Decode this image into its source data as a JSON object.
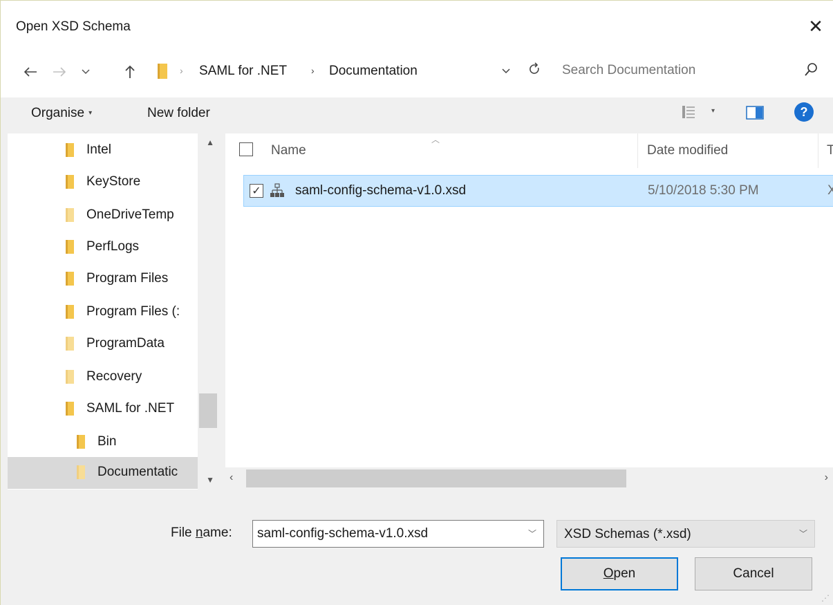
{
  "window": {
    "title": "Open XSD Schema",
    "close_glyph": "✕"
  },
  "address": {
    "breadcrumb": [
      "SAML for .NET",
      "Documentation"
    ],
    "search_placeholder": "Search Documentation"
  },
  "toolbar": {
    "organise_label": "Organise",
    "new_folder_label": "New folder",
    "help_glyph": "?"
  },
  "nav_tree": {
    "items": [
      {
        "label": "Intel",
        "folder_style": "dark"
      },
      {
        "label": "KeyStore",
        "folder_style": "dark"
      },
      {
        "label": "OneDriveTemp",
        "folder_style": "light"
      },
      {
        "label": "PerfLogs",
        "folder_style": "dark"
      },
      {
        "label": "Program Files",
        "folder_style": "dark"
      },
      {
        "label": "Program Files (:",
        "folder_style": "dark"
      },
      {
        "label": "ProgramData",
        "folder_style": "light"
      },
      {
        "label": "Recovery",
        "folder_style": "light"
      },
      {
        "label": "SAML for .NET",
        "folder_style": "dark"
      },
      {
        "label": "Bin",
        "folder_style": "dark"
      },
      {
        "label": "Documentatic",
        "folder_style": "light",
        "selected": true
      }
    ]
  },
  "file_list": {
    "columns": [
      "Name",
      "Date modified",
      "T"
    ],
    "rows": [
      {
        "name": "saml-config-schema-v1.0.xsd",
        "date_modified": "5/10/2018 5:30 PM",
        "type": "X",
        "checked": true,
        "selected": true
      }
    ]
  },
  "footer": {
    "file_name_label_prefix": "File ",
    "file_name_label_hotkey": "n",
    "file_name_label_suffix": "ame:",
    "file_name_value": "saml-config-schema-v1.0.xsd",
    "file_type_value": "XSD Schemas (*.xsd)",
    "open_hotkey": "O",
    "open_rest": "pen",
    "cancel_label": "Cancel"
  },
  "colors": {
    "selection_bg": "#cce8ff",
    "selection_border": "#99d1ff",
    "accent": "#0078d7",
    "folder": "#f4c64d"
  }
}
